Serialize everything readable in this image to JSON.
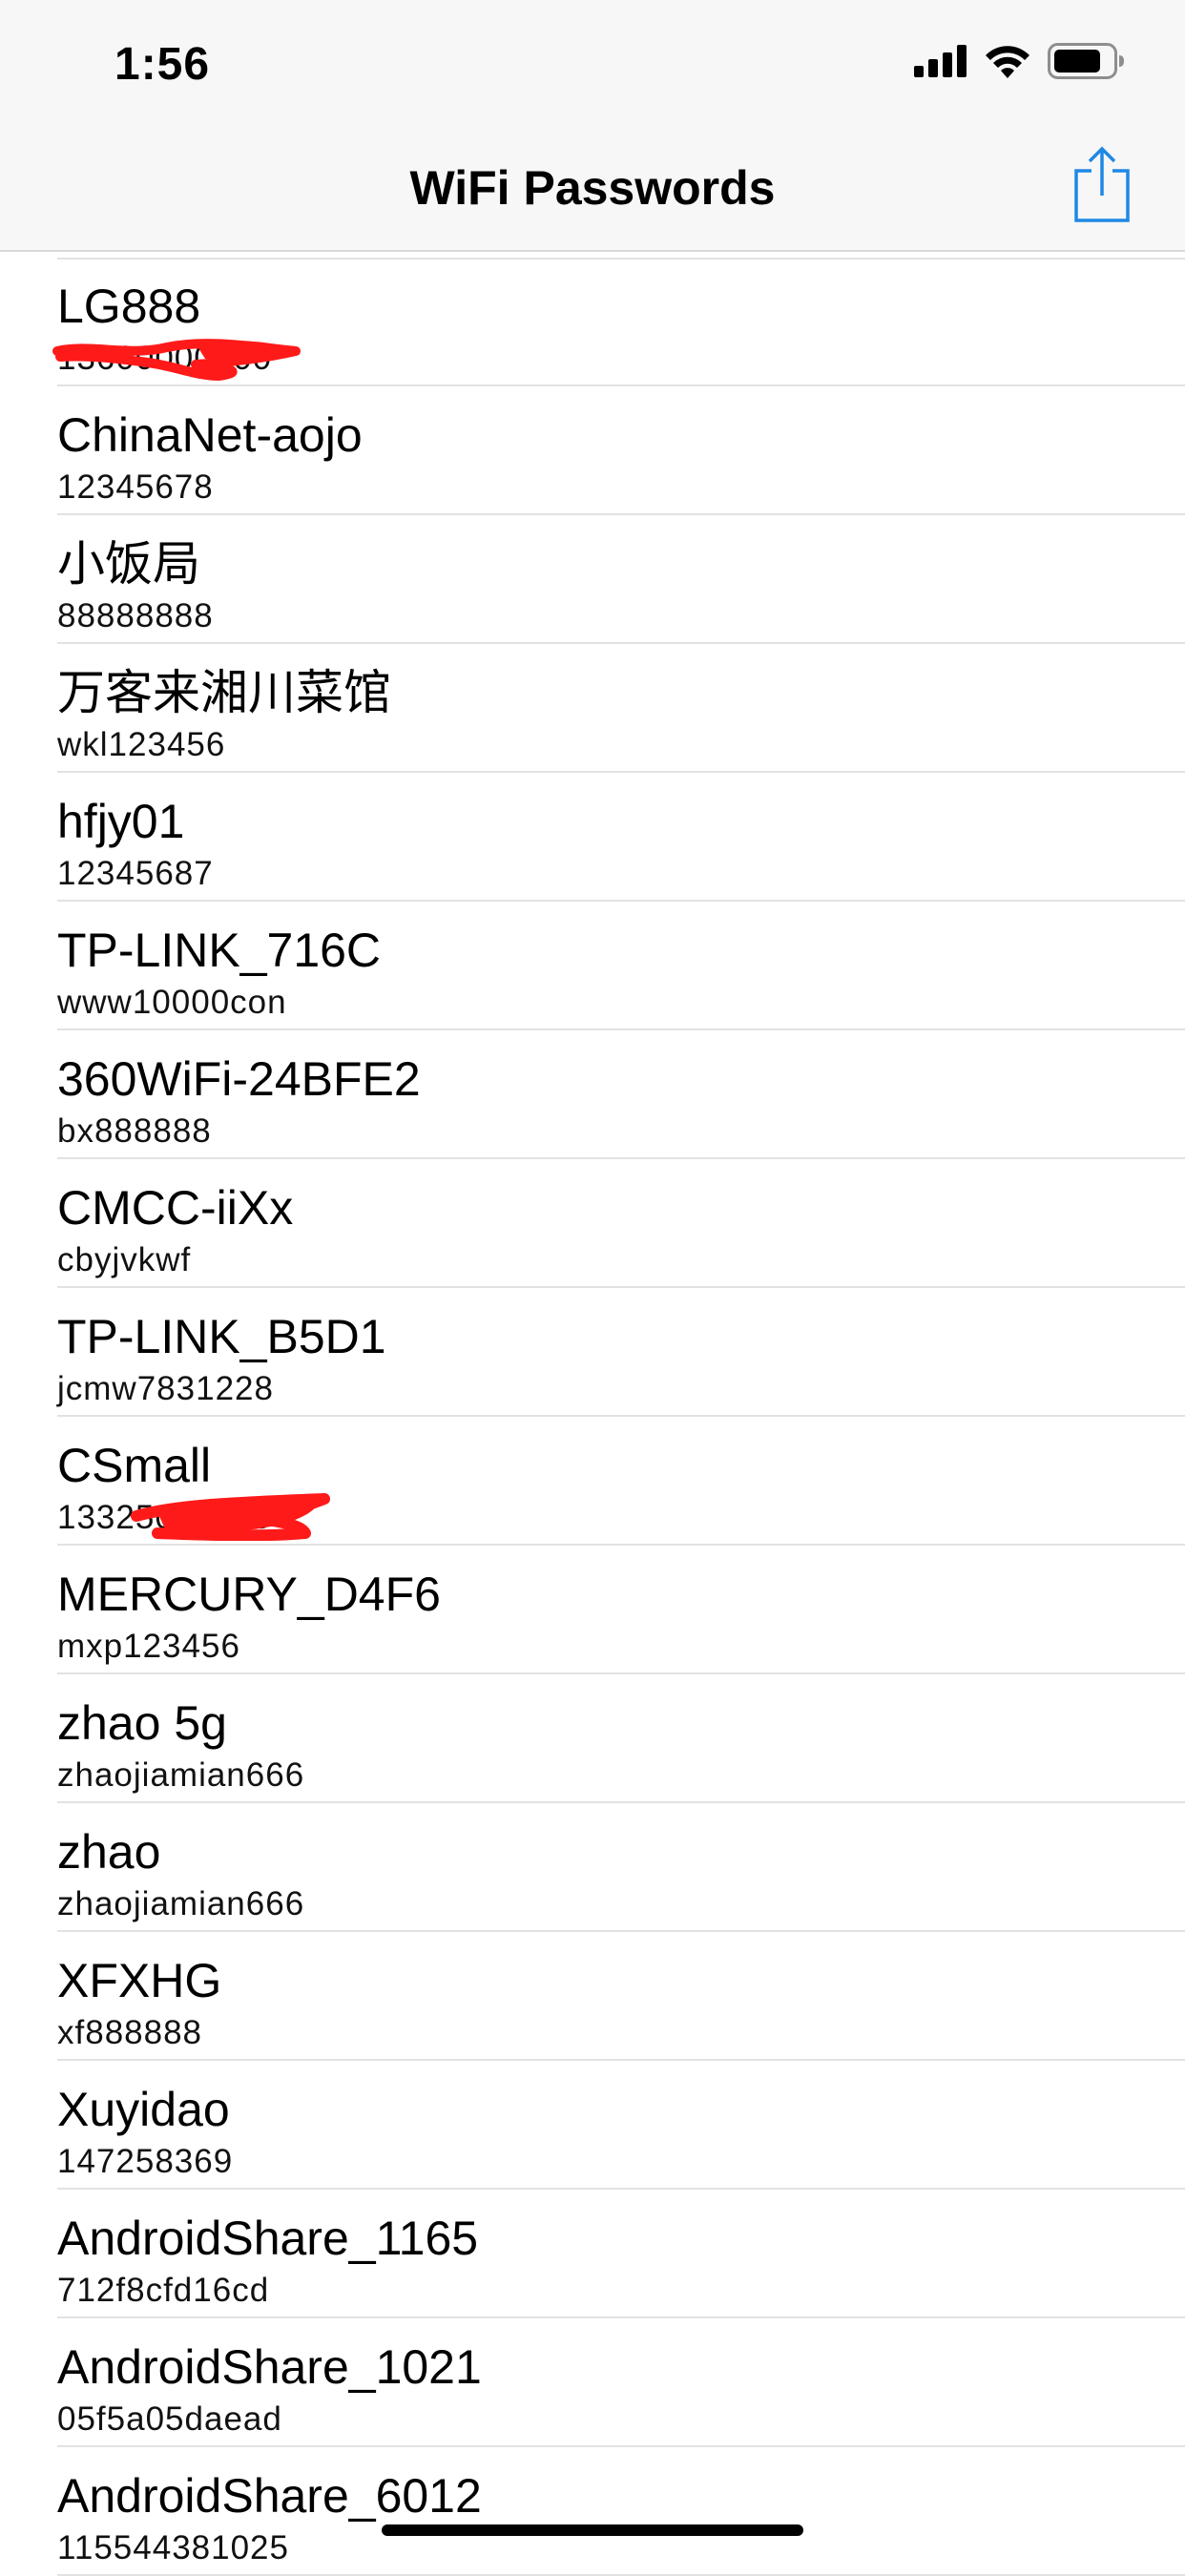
{
  "status_bar": {
    "time": "1:56",
    "icons": [
      "cellular-signal-icon",
      "wifi-icon",
      "battery-icon"
    ]
  },
  "nav": {
    "title": "WiFi Passwords",
    "share_icon": "share-icon",
    "accent_color": "#1e88e5"
  },
  "networks": [
    {
      "ssid": "LG888",
      "password": "13600000000"
    },
    {
      "ssid": "ChinaNet-aojo",
      "password": "12345678"
    },
    {
      "ssid": "小饭局",
      "password": "88888888"
    },
    {
      "ssid": "万客来湘川菜馆",
      "password": "wkl123456"
    },
    {
      "ssid": "hfjy01",
      "password": "12345687"
    },
    {
      "ssid": "TP-LINK_716C",
      "password": "www10000con"
    },
    {
      "ssid": "360WiFi-24BFE2",
      "password": "bx888888"
    },
    {
      "ssid": "CMCC-iiXx",
      "password": "cbyjvkwf"
    },
    {
      "ssid": "TP-LINK_B5D1",
      "password": "jcmw7831228"
    },
    {
      "ssid": "CSmall",
      "password": "13325000000"
    },
    {
      "ssid": "MERCURY_D4F6",
      "password": "mxp123456"
    },
    {
      "ssid": "zhao 5g",
      "password": "zhaojiamian666"
    },
    {
      "ssid": "zhao",
      "password": "zhaojiamian666"
    },
    {
      "ssid": "XFXHG",
      "password": "xf888888"
    },
    {
      "ssid": "Xuyidao",
      "password": "147258369"
    },
    {
      "ssid": "AndroidShare_1165",
      "password": "712f8cfd16cd"
    },
    {
      "ssid": "AndroidShare_1021",
      "password": "05f5a05daead"
    },
    {
      "ssid": "AndroidShare_6012",
      "password": "115544381025"
    }
  ],
  "redaction_color": "#ff1a1a"
}
